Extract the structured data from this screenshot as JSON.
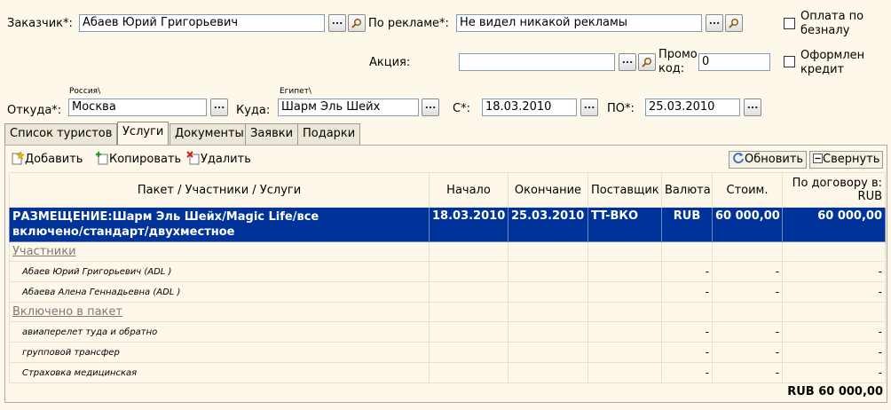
{
  "customer": {
    "label": "Заказчик*:",
    "value": "Абаев Юрий Григорьевич"
  },
  "ad": {
    "label": "По рекламе*:",
    "value": "Не видел никакой рекламы"
  },
  "cashless": {
    "label_line1": "Оплата по",
    "label_line2": "безналу"
  },
  "promo_action": {
    "label": "Акция:",
    "value": ""
  },
  "promo_code": {
    "label_line1": "Промо",
    "label_line2": "код:",
    "value": "0"
  },
  "credit": {
    "label_line1": "Оформлен",
    "label_line2": "кредит"
  },
  "from": {
    "label": "Откуда*:",
    "country": "Россия\\",
    "value": "Москва"
  },
  "to": {
    "label": "Куда:",
    "country": "Египет\\",
    "value": "Шарм Эль Шейх"
  },
  "date_from": {
    "label": "С*:",
    "value": "18.03.2010"
  },
  "date_to": {
    "label": "ПО*:",
    "value": "25.03.2010"
  },
  "ellipsis": "...",
  "tabs": [
    "Список туристов",
    "Услуги",
    "Документы",
    "Заявки",
    "Подарки"
  ],
  "active_tab": "Услуги",
  "toolbar": {
    "add": "Добавить",
    "copy": "Копировать",
    "delete": "Удалить",
    "refresh": "Обновить",
    "collapse": "Свернуть"
  },
  "columns": [
    "Пакет / Участники / Услуги",
    "Начало",
    "Окончание",
    "Поставщик",
    "Валюта",
    "Стоим.",
    "По договору в: RUB"
  ],
  "main_row": {
    "name_line1": "РАЗМЕЩЕНИЕ:Шарм Эль Шейх/Magic Life/все",
    "name_line2": "включено/стандарт/двухместное",
    "start": "18.03.2010",
    "end": "25.03.2010",
    "supplier": "TT-ВКО",
    "currency": "RUB",
    "cost": "60 000,00",
    "contract": "60 000,00"
  },
  "participants_section": "Участники",
  "participants": [
    "Абаев Юрий Григорьевич (ADL )",
    "Абаева Алена Геннадьевна (ADL )"
  ],
  "included_section": "Включено в пакет",
  "included": [
    "авиаперелет туда и обратно",
    "групповой трансфер",
    "Страховка медицинская"
  ],
  "dash": "-",
  "total": "RUB 60 000,00",
  "colors": {
    "selected_row": "#003399",
    "background": "#fdf8e9"
  }
}
